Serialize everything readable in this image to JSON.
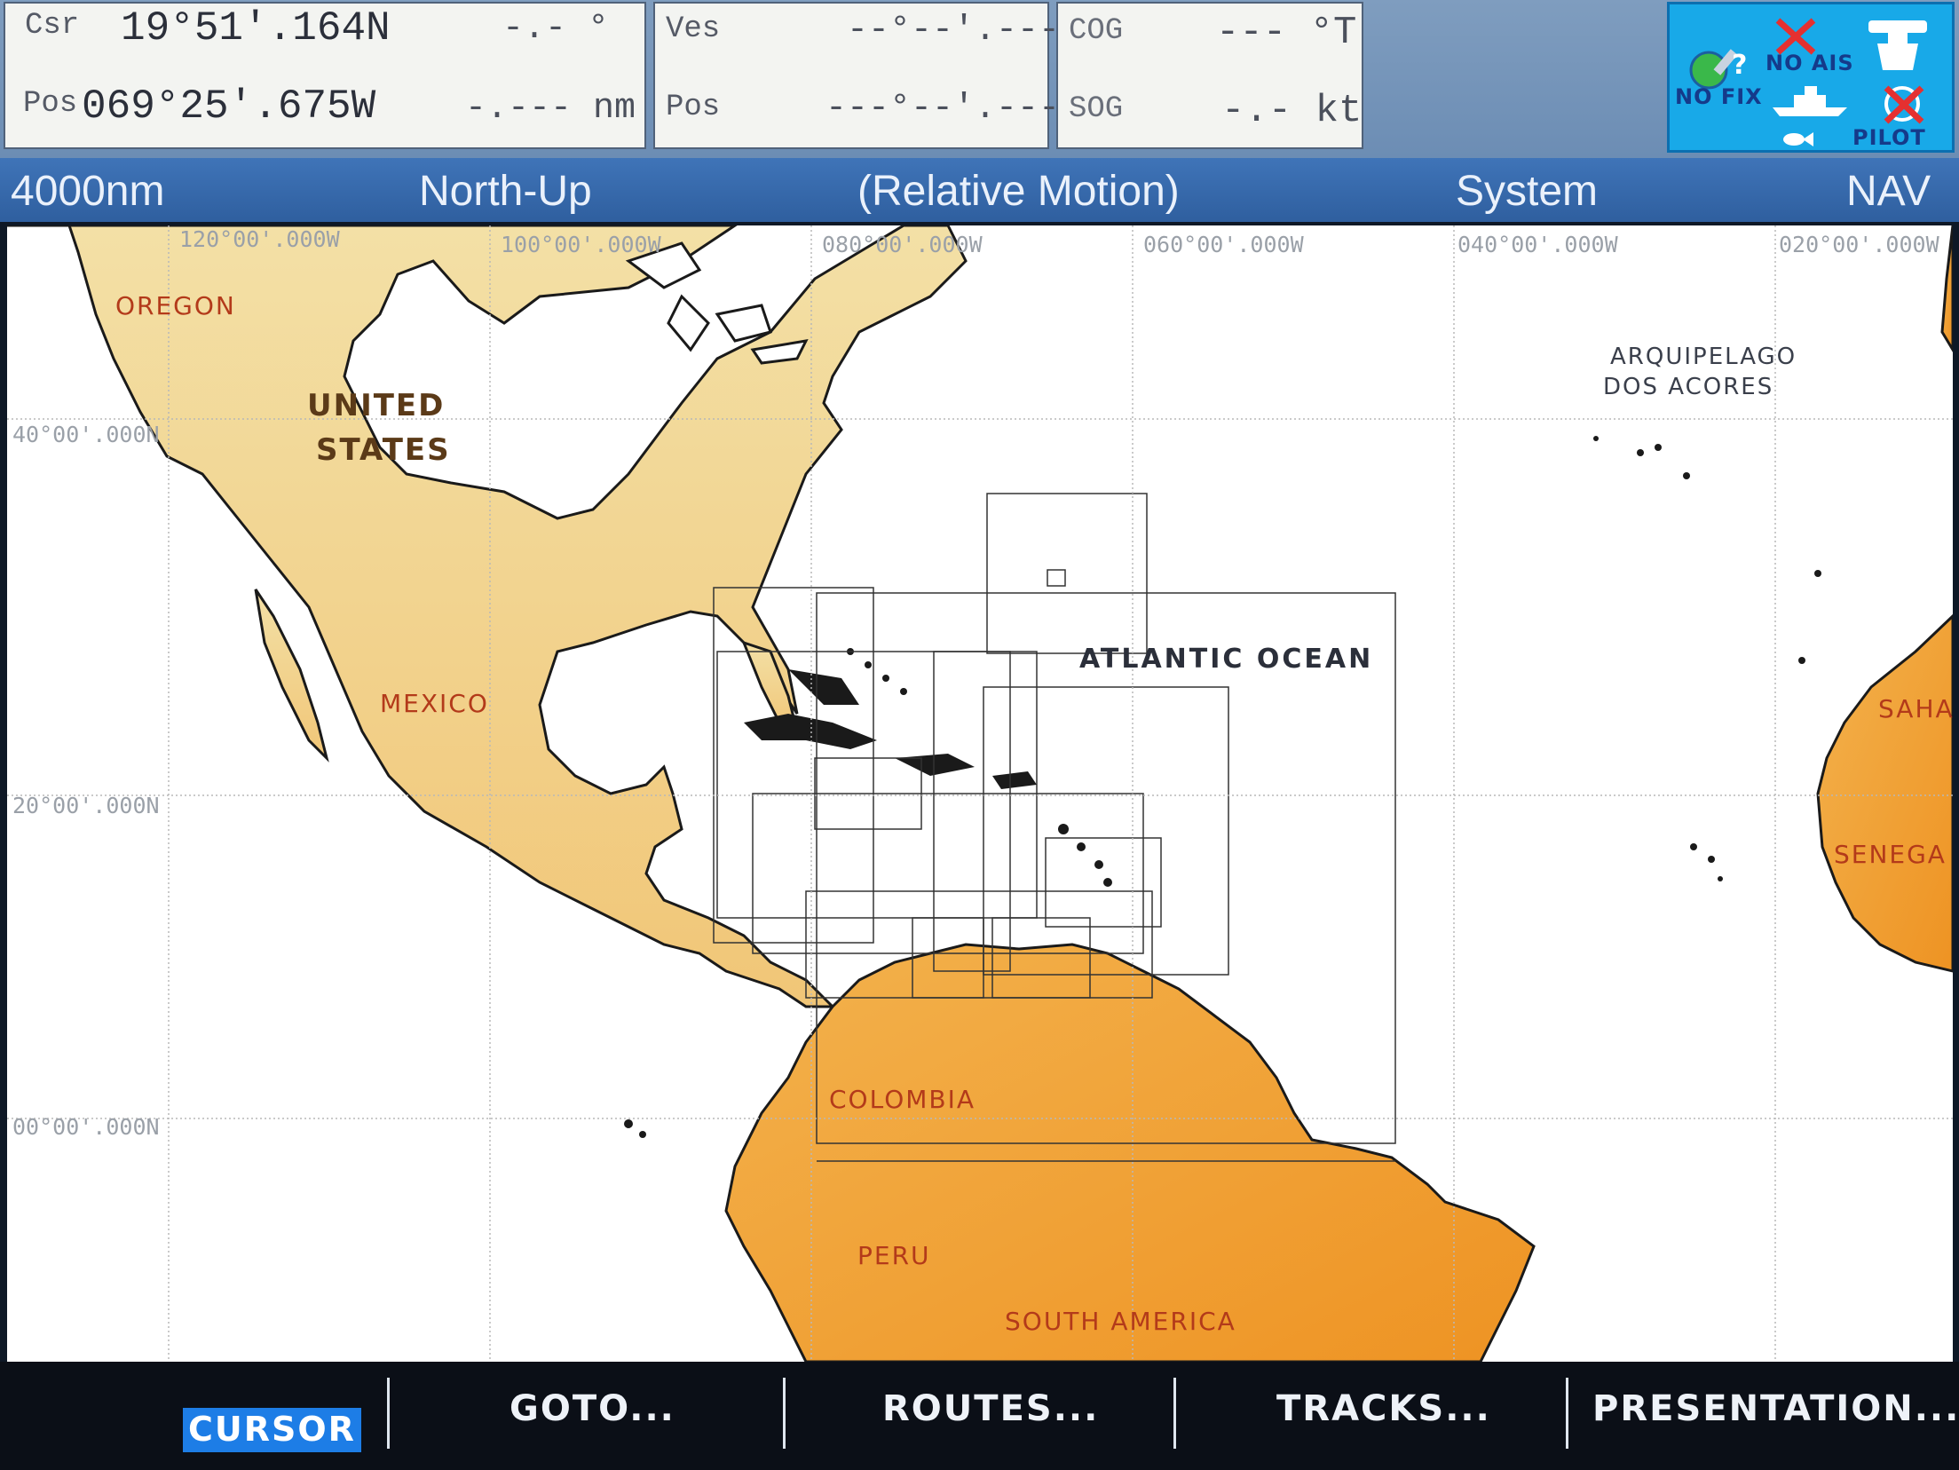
{
  "nav_data": {
    "cursor": {
      "label": "Csr",
      "lat": "19°51'.164N",
      "pos_label": "Pos",
      "lon": "069°25'.675W",
      "bearing": "-.- °",
      "range": "-.--- nm"
    },
    "vessel": {
      "label": "Ves",
      "lat": "--°--'.---",
      "pos_label": "Pos",
      "lon": "---°--'.---"
    },
    "motion": {
      "cog_label": "COG",
      "cog": "--- °T",
      "sog_label": "SOG",
      "sog": "-.- kt"
    }
  },
  "status": {
    "ais": "NO AIS",
    "fix": "NO FIX",
    "pilot": "PILOT"
  },
  "title_bar": {
    "scale": "4000nm",
    "orientation": "North-Up",
    "motion_mode": "(Relative Motion)",
    "system": "System",
    "mode": "NAV"
  },
  "chart": {
    "longitude_labels": [
      "120°00'.000W",
      "100°00'.000W",
      "080°00'.000W",
      "060°00'.000W",
      "040°00'.000W",
      "020°00'.000W"
    ],
    "latitude_labels": [
      "40°00'.000N",
      "20°00'.000N",
      "00°00'.000N"
    ],
    "region_labels": {
      "oregon": "OREGON",
      "us_line1": "UNITED",
      "us_line2": "STATES",
      "mexico": "MEXICO",
      "azores_line1": "ARQUIPELAGO",
      "azores_line2": "DOS ACORES",
      "atlantic": "ATLANTIC OCEAN",
      "sahara": "SAHA",
      "senegal": "SENEGA",
      "colombia": "COLOMBIA",
      "peru": "PERU",
      "south_america": "SOUTH AMERICA"
    },
    "colors": {
      "land_north": "#f3dc9c",
      "land_south": "#f0a53a",
      "coastline": "#1a1a1a",
      "grid": "#b8b8b8"
    }
  },
  "softkeys": [
    "CURSOR",
    "GOTO...",
    "ROUTES...",
    "TRACKS...",
    "PRESENTATION..."
  ]
}
